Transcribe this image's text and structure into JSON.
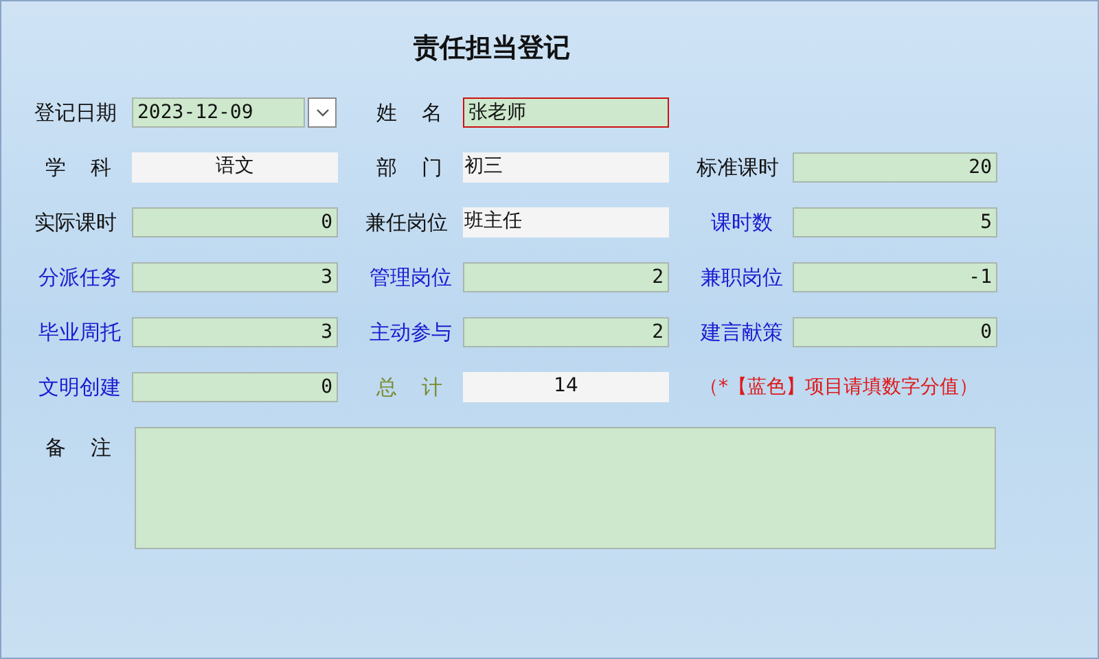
{
  "title": "责任担当登记",
  "rows": [
    [
      {
        "label": "登记日期",
        "kind": "plain",
        "field": {
          "kind": "date",
          "value": "2023-12-09",
          "focused": false
        }
      },
      {
        "label": "姓 名",
        "kind": "spaced",
        "field": {
          "kind": "text",
          "value": "张老师",
          "focused": true
        }
      }
    ],
    [
      {
        "label": "学 科",
        "kind": "spaced",
        "field": {
          "kind": "display-center",
          "value": "语文",
          "focused": false
        }
      },
      {
        "label": "部 门",
        "kind": "spaced",
        "field": {
          "kind": "display",
          "value": "初三",
          "focused": false
        }
      },
      {
        "label": "标准课时",
        "kind": "plain",
        "field": {
          "kind": "number",
          "value": "20",
          "focused": false
        }
      }
    ],
    [
      {
        "label": "实际课时",
        "kind": "plain",
        "field": {
          "kind": "number",
          "value": "0",
          "focused": false
        }
      },
      {
        "label": "兼任岗位",
        "kind": "plain",
        "field": {
          "kind": "display",
          "value": "班主任",
          "focused": false
        }
      },
      {
        "label": "课时数",
        "kind": "score",
        "field": {
          "kind": "number",
          "value": "5",
          "focused": false
        }
      }
    ],
    [
      {
        "label": "分派任务",
        "kind": "score",
        "field": {
          "kind": "number",
          "value": "3",
          "focused": false
        }
      },
      {
        "label": "管理岗位",
        "kind": "score",
        "field": {
          "kind": "number",
          "value": "2",
          "focused": false
        }
      },
      {
        "label": "兼职岗位",
        "kind": "score",
        "field": {
          "kind": "number",
          "value": "-1",
          "focused": false
        }
      }
    ],
    [
      {
        "label": "毕业周托",
        "kind": "score",
        "field": {
          "kind": "number",
          "value": "3",
          "focused": false
        }
      },
      {
        "label": "主动参与",
        "kind": "score",
        "field": {
          "kind": "number",
          "value": "2",
          "focused": false
        }
      },
      {
        "label": "建言献策",
        "kind": "score",
        "field": {
          "kind": "number",
          "value": "0",
          "focused": false
        }
      }
    ],
    [
      {
        "label": "文明创建",
        "kind": "score",
        "field": {
          "kind": "number",
          "value": "0",
          "focused": false
        }
      },
      {
        "label": "总 计",
        "kind": "total",
        "field": {
          "kind": "display-center",
          "value": "14",
          "focused": false
        }
      },
      {
        "kind": "note",
        "note": "（*【蓝色】项目请填数字分值）"
      }
    ]
  ],
  "remarks": {
    "label": "备 注"
  }
}
